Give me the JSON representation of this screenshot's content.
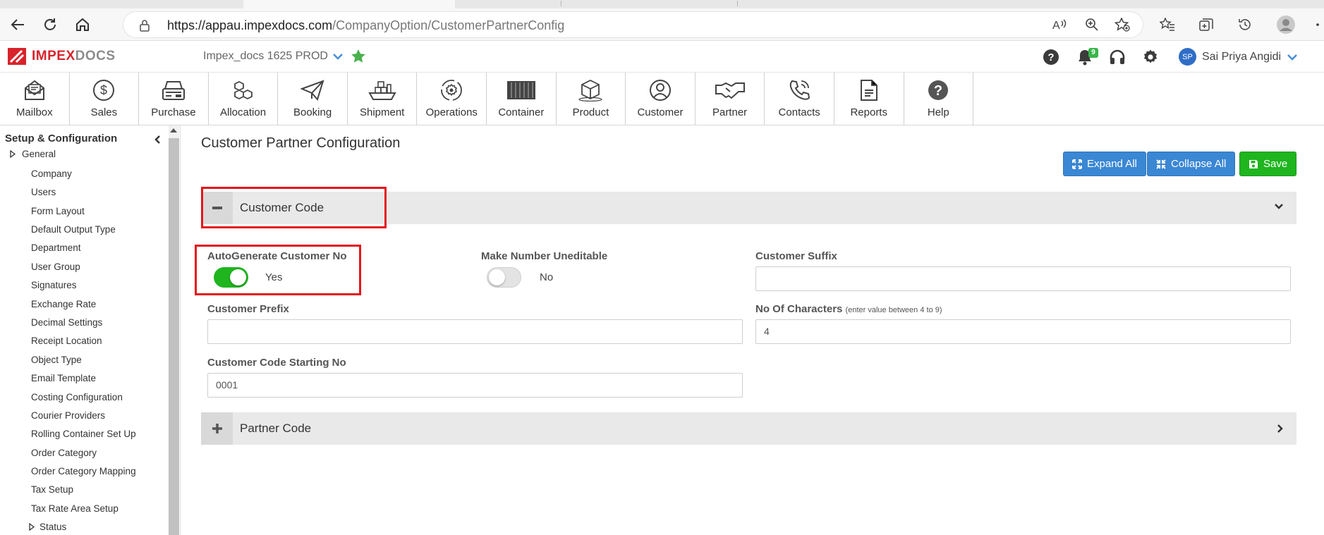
{
  "browser": {
    "url_host": "https://appau.impexdocs.com",
    "url_path": "/CompanyOption/CustomerPartnerConfig"
  },
  "header": {
    "logo_a": "IMPEX",
    "logo_b": "DOCS",
    "company": "Impex_docs 1625 PROD",
    "notification_count": "9",
    "user_initials": "SP",
    "user_name": "Sai Priya Angidi"
  },
  "modules": [
    {
      "label": "Mailbox",
      "icon": "mailbox-icon"
    },
    {
      "label": "Sales",
      "icon": "dollar-icon"
    },
    {
      "label": "Purchase",
      "icon": "cash-register-icon"
    },
    {
      "label": "Allocation",
      "icon": "boxes-icon"
    },
    {
      "label": "Booking",
      "icon": "paper-plane-icon"
    },
    {
      "label": "Shipment",
      "icon": "ship-icon"
    },
    {
      "label": "Operations",
      "icon": "gear-cycle-icon"
    },
    {
      "label": "Container",
      "icon": "container-icon"
    },
    {
      "label": "Product",
      "icon": "box-icon"
    },
    {
      "label": "Customer",
      "icon": "user-circle-icon"
    },
    {
      "label": "Partner",
      "icon": "handshake-icon"
    },
    {
      "label": "Contacts",
      "icon": "phone-icon"
    },
    {
      "label": "Reports",
      "icon": "document-icon"
    },
    {
      "label": "Help",
      "icon": "help-icon"
    }
  ],
  "sidebar": {
    "title": "Setup & Configuration",
    "groups": [
      "General",
      "Status"
    ],
    "items": [
      "Company",
      "Users",
      "Form Layout",
      "Default Output Type",
      "Department",
      "User Group",
      "Signatures",
      "Exchange Rate",
      "Decimal Settings",
      "Receipt Location",
      "Object Type",
      "Email Template",
      "Costing Configuration",
      "Courier Providers",
      "Rolling Container Set Up",
      "Order Category",
      "Order Category Mapping",
      "Tax Setup",
      "Tax Rate Area Setup"
    ]
  },
  "main": {
    "title": "Customer Partner Configuration",
    "expand_all": "Expand All",
    "collapse_all": "Collapse All",
    "save": "Save",
    "customer_section": {
      "title": "Customer Code",
      "autogen_label": "AutoGenerate Customer No",
      "autogen_state": "Yes",
      "uneditable_label": "Make Number Uneditable",
      "uneditable_state": "No",
      "suffix_label": "Customer Suffix",
      "suffix_value": "",
      "prefix_label": "Customer Prefix",
      "prefix_value": "",
      "chars_label": "No Of Characters",
      "chars_hint": "(enter value between 4 to 9)",
      "chars_value": "4",
      "start_label": "Customer Code Starting No",
      "start_value": "0001"
    },
    "partner_section": {
      "title": "Partner Code"
    }
  },
  "colors": {
    "accent_blue": "#3a87d4",
    "save_green": "#1fb51f",
    "highlight_red": "#e5151b",
    "brand_red": "#d8232a"
  }
}
